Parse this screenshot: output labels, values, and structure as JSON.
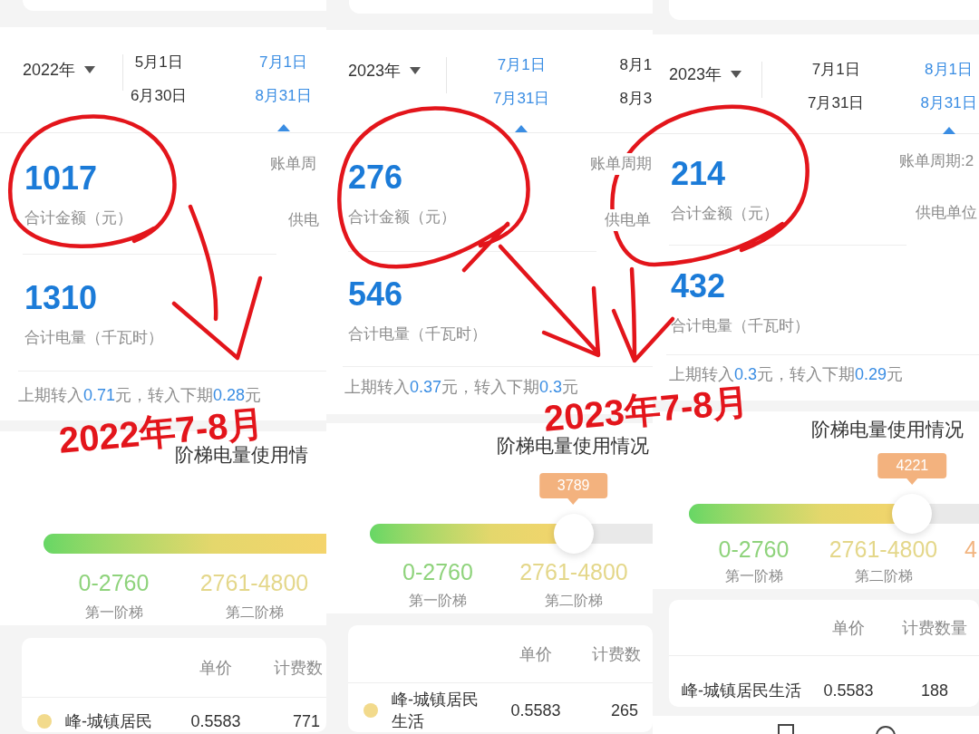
{
  "panels": [
    {
      "year": "2022年",
      "periods": [
        {
          "start": "5月1日",
          "end": "6月30日",
          "selected": false
        },
        {
          "start": "7月1日",
          "end": "8月31日",
          "selected": true
        }
      ],
      "summary": {
        "amount": {
          "value": "1017",
          "label": "合计金额（元）"
        },
        "energy": {
          "value": "1310",
          "label": "合计电量（千瓦时）"
        },
        "side_labels": [
          "账单周",
          "供电"
        ],
        "carryover": [
          {
            "text": "上期转入",
            "highlight": false
          },
          {
            "text": "0.71",
            "highlight": true
          },
          {
            "text": "元，转入下期",
            "highlight": false
          },
          {
            "text": "0.28",
            "highlight": true
          },
          {
            "text": "元",
            "highlight": false
          }
        ]
      },
      "tier_usage": {
        "title": "阶梯电量使用情",
        "slider": {
          "level": 1
        },
        "tiers": [
          {
            "range": "0-2760",
            "name": "第一阶梯",
            "color": "#8fd37c"
          },
          {
            "range": "2761-4800",
            "name": "第二阶梯",
            "color": "#e4d78a"
          }
        ]
      },
      "table": {
        "columns": [
          "单价",
          "计费数"
        ],
        "rows": [
          {
            "name": "峰-城镇居民",
            "price": "0.5583",
            "quantity": "771",
            "color": "#f2da8c"
          }
        ]
      }
    },
    {
      "year": "2023年",
      "periods": [
        {
          "start": "7月1日",
          "end": "7月31日",
          "selected": true
        },
        {
          "start": "8月1",
          "end": "8月3",
          "selected": false
        }
      ],
      "summary": {
        "amount": {
          "value": "276",
          "label": "合计金额（元）"
        },
        "energy": {
          "value": "546",
          "label": "合计电量（千瓦时）"
        },
        "side_labels": [
          "账单周期",
          "供电单"
        ],
        "carryover": [
          {
            "text": "上期转入",
            "highlight": false
          },
          {
            "text": "0.37",
            "highlight": true
          },
          {
            "text": "元，转入下期",
            "highlight": false
          },
          {
            "text": "0.3",
            "highlight": true
          },
          {
            "text": "元",
            "highlight": false
          }
        ]
      },
      "tier_usage": {
        "title": "阶梯电量使用情况",
        "slider": {
          "level": 0.72,
          "reading": "3789"
        },
        "tiers": [
          {
            "range": "0-2760",
            "name": "第一阶梯",
            "color": "#8fd37c"
          },
          {
            "range": "2761-4800",
            "name": "第二阶梯",
            "color": "#e4d78a"
          }
        ]
      },
      "table": {
        "columns": [
          "单价",
          "计费数"
        ],
        "rows": [
          {
            "name": "峰-城镇居民生活",
            "price": "0.5583",
            "quantity": "265",
            "color": "#f2da8c"
          }
        ]
      }
    },
    {
      "year": "2023年",
      "periods": [
        {
          "start": "7月1日",
          "end": "7月31日",
          "selected": false
        },
        {
          "start": "8月1日",
          "end": "8月31日",
          "selected": true
        }
      ],
      "summary": {
        "amount": {
          "value": "214",
          "label": "合计金额（元）"
        },
        "energy": {
          "value": "432",
          "label": "合计电量（千瓦时）"
        },
        "side_labels": [
          "账单周期:2",
          "供电单位"
        ],
        "carryover": [
          {
            "text": "上期转入",
            "highlight": false
          },
          {
            "text": "0.3",
            "highlight": true
          },
          {
            "text": "元，转入下期",
            "highlight": false
          },
          {
            "text": "0.29",
            "highlight": true
          },
          {
            "text": "元",
            "highlight": false
          }
        ]
      },
      "tier_usage": {
        "title": "阶梯电量使用情况",
        "slider": {
          "level": 0.77,
          "reading": "4221"
        },
        "tiers": [
          {
            "range": "0-2760",
            "name": "第一阶梯",
            "color": "#8fd37c"
          },
          {
            "range": "2761-4800",
            "name": "第二阶梯",
            "color": "#e4d78a"
          },
          {
            "range": "4",
            "color": "#f2b47f"
          }
        ]
      },
      "table": {
        "columns": [
          "单价",
          "计费数量"
        ],
        "rows": [
          {
            "name": "峰-城镇居民生活",
            "price": "0.5583",
            "quantity": "188"
          }
        ]
      },
      "navigation_bar": true
    }
  ],
  "handwritten_notes": [
    {
      "text": "2022年7-8月"
    },
    {
      "text": "2023年7-8月"
    }
  ]
}
